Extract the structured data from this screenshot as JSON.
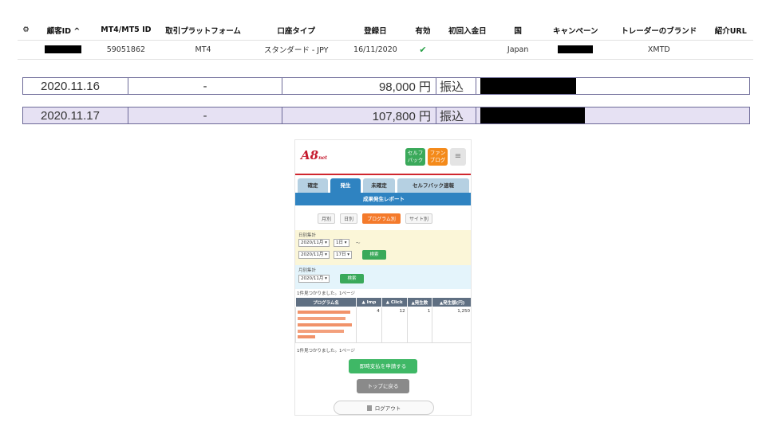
{
  "account_table": {
    "settings_icon": "gear-icon",
    "headers": [
      "顧客ID ^",
      "MT4/MT5 ID",
      "取引プラットフォーム",
      "口座タイプ",
      "登録日",
      "有効",
      "初回入金日",
      "国",
      "キャンペーン",
      "トレーダーのブランド",
      "紹介URL"
    ],
    "row": {
      "mt_id": "59051862",
      "platform": "MT4",
      "account_type": "スタンダード - JPY",
      "registered": "16/11/2020",
      "active_icon": "check-icon",
      "active_mark": "✔",
      "first_deposit": "",
      "country": "Japan",
      "brand": "XMTD",
      "ref_url": ""
    }
  },
  "deposits": [
    {
      "date": "2020.11.16",
      "dash": "-",
      "amount": "98,000 円",
      "method": "振込"
    },
    {
      "date": "2020.11.17",
      "dash": "-",
      "amount": "107,800 円",
      "method": "振込"
    }
  ],
  "phone": {
    "logo": "A8",
    "logo_suffix": "net",
    "self_back": "セルフ\nバック",
    "fan_blog": "ファン\nブログ",
    "menu_icon": "≡",
    "tabs": [
      "確定",
      "発生",
      "未確定",
      "セルフバック速報"
    ],
    "report_title": "成果発生レポート",
    "filters": [
      "月別",
      "日別",
      "プログラム別",
      "サイト別"
    ],
    "daily_label": "日別集計",
    "daily_from_month": "2020/11月 ▾",
    "daily_from_day": "1日 ▾",
    "daily_tilde": "〜",
    "daily_to_month": "2020/11月 ▾",
    "daily_to_day": "17日 ▾",
    "search": "検索",
    "monthly_label": "月別集計",
    "monthly_month": "2020/11月 ▾",
    "found_text": "1件見つかりました。1ページ",
    "table_headers": [
      "プログラム名",
      "▲ Imp",
      "▲ Click",
      "▲発生数",
      "▲発生額(円)"
    ],
    "row": {
      "name": "",
      "imp": "4",
      "click": "12",
      "count": "1",
      "amount": "1,250"
    },
    "payout_button": "即時支払を申請する",
    "top_button": "トップに戻る",
    "logout": "ログアウト"
  }
}
